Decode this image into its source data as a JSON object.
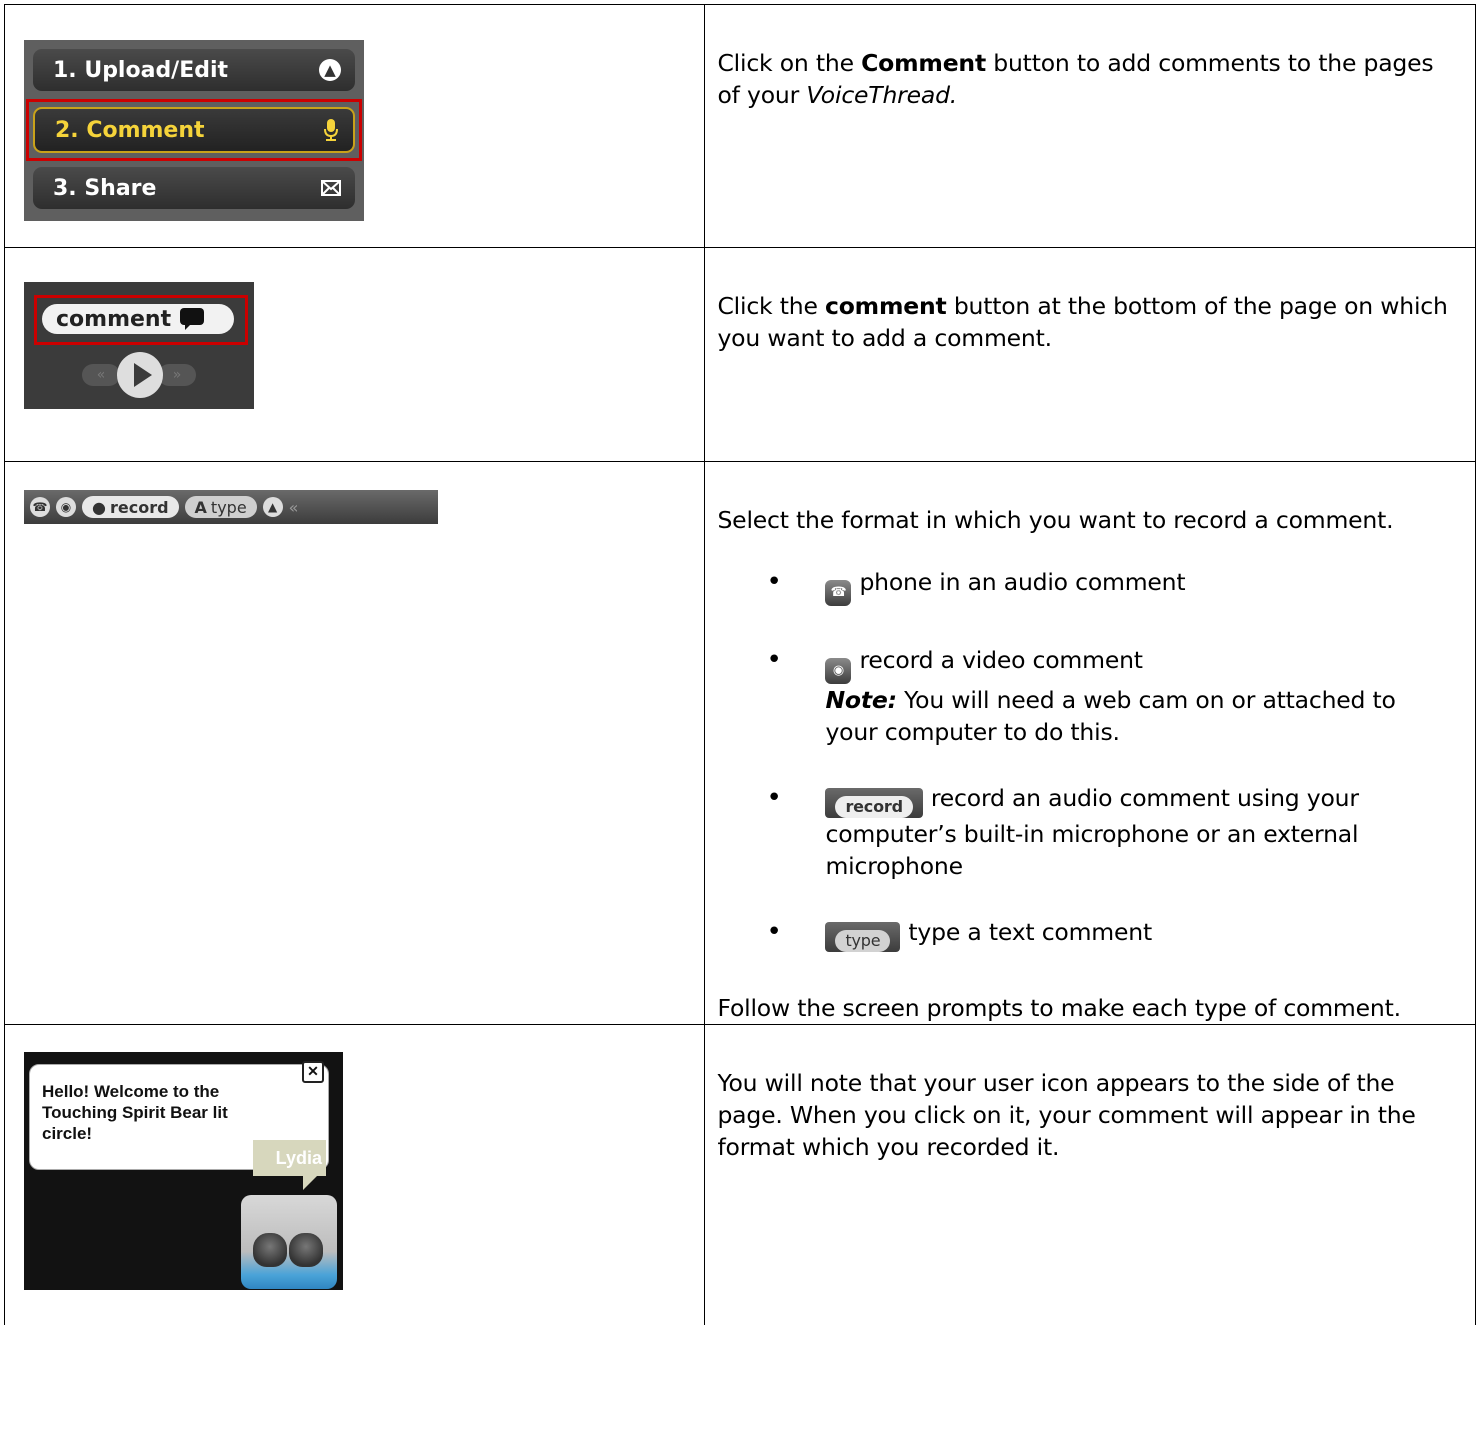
{
  "rows": [
    {
      "menu": {
        "items": [
          {
            "label": "1. Upload/Edit",
            "icon": "upload-arrow-icon"
          },
          {
            "label": "2. Comment",
            "icon": "microphone-icon"
          },
          {
            "label": "3. Share",
            "icon": "envelope-icon"
          }
        ],
        "active_color": "#f5d33a",
        "highlight_color": "#cc0000"
      },
      "text_before": "Click on the ",
      "text_bold": "Comment",
      "text_mid": " button to add comments to the pages of your ",
      "text_italic": "VoiceThread."
    },
    {
      "comment_button_label": "comment",
      "text_before": "Click the ",
      "text_bold": "comment",
      "text_after": " button at the bottom of the page on which you want to add a comment."
    },
    {
      "toolbar": {
        "record_label": "record",
        "type_label": "type"
      },
      "intro": "Select the format in which you want to record a comment.",
      "options": [
        {
          "text": "phone in an audio comment"
        },
        {
          "text": "record a video comment",
          "note_label": "Note:",
          "note_text": "  You will need a web cam on or attached to your computer to do this."
        },
        {
          "text": "record an audio comment using your computer’s built-in microphone or an external microphone"
        },
        {
          "text": "type a text comment"
        }
      ],
      "outro": "Follow the screen prompts to make each type of comment."
    },
    {
      "bubble_text": "Hello! Welcome to the Touching Spirit Bear lit circle!",
      "user_name": "Lydia",
      "text": "You will note that your user icon appears to the side of the page.  When you click on it, your comment will appear in the format which you recorded it."
    }
  ]
}
